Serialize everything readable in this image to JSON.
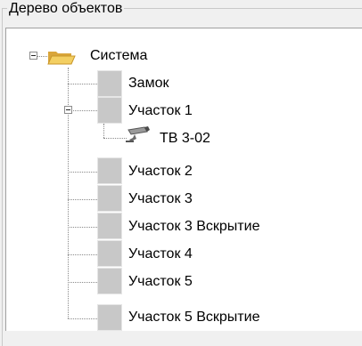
{
  "panel": {
    "title": "Дерево объектов"
  },
  "tree": {
    "root": {
      "label": "Система",
      "icon": "folder-icon",
      "expanded": true
    },
    "items": [
      {
        "label": "Замок",
        "icon": "device-icon"
      },
      {
        "label": "Участок 1",
        "icon": "device-icon",
        "expanded": true,
        "children": [
          {
            "label": "ТВ 3-02",
            "icon": "camera-icon"
          }
        ]
      },
      {
        "label": "Участок 2",
        "icon": "device-icon"
      },
      {
        "label": "Участок 3",
        "icon": "device-icon"
      },
      {
        "label": "Участок 3 Вскрытие",
        "icon": "device-icon"
      },
      {
        "label": "Участок 4",
        "icon": "device-icon"
      },
      {
        "label": "Участок 5",
        "icon": "device-icon"
      },
      {
        "label": "Участок 5 Вскрытие",
        "icon": "device-icon"
      }
    ]
  },
  "colors": {
    "icon_gray": "#c8c8c8",
    "folder": "#f3cf62"
  }
}
